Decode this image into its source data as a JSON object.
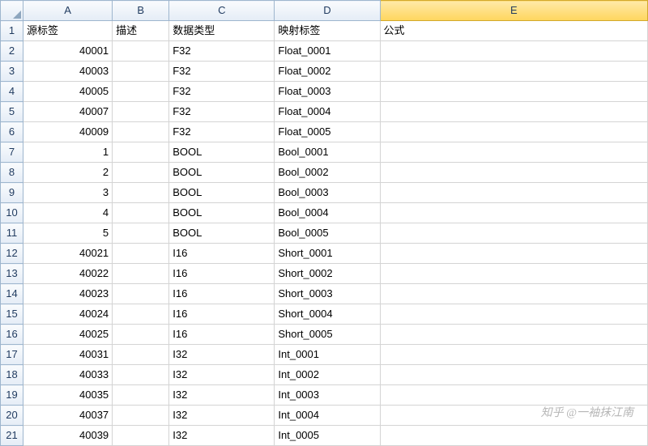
{
  "columns": [
    "A",
    "B",
    "C",
    "D",
    "E"
  ],
  "selected_column": "E",
  "headers": {
    "A": "源标签",
    "B": "描述",
    "C": "数据类型",
    "D": "映射标签",
    "E": "公式"
  },
  "rows": [
    {
      "n": 1,
      "A": "源标签",
      "B": "描述",
      "C": "数据类型",
      "D": "映射标签",
      "E": "公式",
      "headerRow": true
    },
    {
      "n": 2,
      "A": "40001",
      "B": "",
      "C": "F32",
      "D": "Float_0001",
      "E": ""
    },
    {
      "n": 3,
      "A": "40003",
      "B": "",
      "C": "F32",
      "D": "Float_0002",
      "E": ""
    },
    {
      "n": 4,
      "A": "40005",
      "B": "",
      "C": "F32",
      "D": "Float_0003",
      "E": ""
    },
    {
      "n": 5,
      "A": "40007",
      "B": "",
      "C": "F32",
      "D": "Float_0004",
      "E": ""
    },
    {
      "n": 6,
      "A": "40009",
      "B": "",
      "C": "F32",
      "D": "Float_0005",
      "E": ""
    },
    {
      "n": 7,
      "A": "1",
      "B": "",
      "C": "BOOL",
      "D": "Bool_0001",
      "E": ""
    },
    {
      "n": 8,
      "A": "2",
      "B": "",
      "C": "BOOL",
      "D": "Bool_0002",
      "E": ""
    },
    {
      "n": 9,
      "A": "3",
      "B": "",
      "C": "BOOL",
      "D": "Bool_0003",
      "E": ""
    },
    {
      "n": 10,
      "A": "4",
      "B": "",
      "C": "BOOL",
      "D": "Bool_0004",
      "E": ""
    },
    {
      "n": 11,
      "A": "5",
      "B": "",
      "C": "BOOL",
      "D": "Bool_0005",
      "E": ""
    },
    {
      "n": 12,
      "A": "40021",
      "B": "",
      "C": "I16",
      "D": "Short_0001",
      "E": ""
    },
    {
      "n": 13,
      "A": "40022",
      "B": "",
      "C": "I16",
      "D": "Short_0002",
      "E": ""
    },
    {
      "n": 14,
      "A": "40023",
      "B": "",
      "C": "I16",
      "D": "Short_0003",
      "E": ""
    },
    {
      "n": 15,
      "A": "40024",
      "B": "",
      "C": "I16",
      "D": "Short_0004",
      "E": ""
    },
    {
      "n": 16,
      "A": "40025",
      "B": "",
      "C": "I16",
      "D": "Short_0005",
      "E": ""
    },
    {
      "n": 17,
      "A": "40031",
      "B": "",
      "C": "I32",
      "D": "Int_0001",
      "E": ""
    },
    {
      "n": 18,
      "A": "40033",
      "B": "",
      "C": "I32",
      "D": "Int_0002",
      "E": ""
    },
    {
      "n": 19,
      "A": "40035",
      "B": "",
      "C": "I32",
      "D": "Int_0003",
      "E": ""
    },
    {
      "n": 20,
      "A": "40037",
      "B": "",
      "C": "I32",
      "D": "Int_0004",
      "E": ""
    },
    {
      "n": 21,
      "A": "40039",
      "B": "",
      "C": "I32",
      "D": "Int_0005",
      "E": ""
    }
  ],
  "watermark": "知乎 @一袖抹江南"
}
